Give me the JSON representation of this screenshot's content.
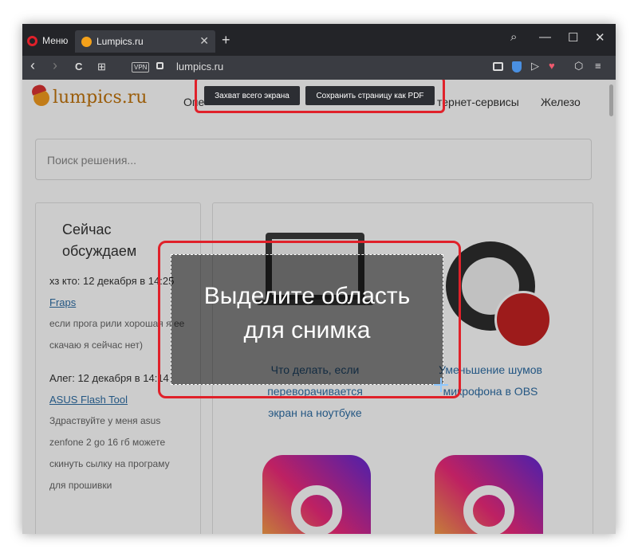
{
  "browser": {
    "menu_label": "Меню",
    "tab_title": "Lumpics.ru",
    "tab_close": "✕",
    "new_tab": "+",
    "address": "lumpics.ru",
    "vpn_badge": "VPN",
    "window_controls": {
      "search": "⌕",
      "minimize": "—",
      "maximize": "☐",
      "close": "✕"
    },
    "nav": {
      "back": "‹",
      "forward": "›",
      "reload": "C",
      "grid": "⊞"
    }
  },
  "snapshot_toolbar": {
    "full_screen_label": "Захват всего экрана",
    "save_pdf_label": "Сохранить страницу как PDF"
  },
  "selection": {
    "hint_line1": "Выделите область",
    "hint_line2": "для снимка"
  },
  "page": {
    "logo_text": "lumpics.ru",
    "nav_partial_left": "Опе",
    "nav_partial_internet": "тернет-сервисы",
    "nav_hardware": "Железо",
    "search_placeholder": "Поиск решения...",
    "discussions": {
      "title": "Сейчас обсуждаем",
      "entries": [
        {
          "meta": "хз кто: 12 декабря в 14:25",
          "link": "Fraps",
          "text": "если прога рили хорошая я ее скачаю я сейчас нет)"
        },
        {
          "meta": "Алег: 12 декабря в 14:14",
          "link": "ASUS Flash Tool",
          "text": "Здраствуйте у меня asus zenfone 2 go 16 гб можете скинуть сылку на програму для прошивки"
        }
      ]
    },
    "articles": [
      {
        "title": "Что делать, если переворачивается экран на ноутбуке"
      },
      {
        "title": "Уменьшение шумов микрофона в OBS"
      }
    ]
  },
  "colors": {
    "accent_red": "#e0212a",
    "link_blue": "#2e6da4",
    "logo_orange": "#c1730b"
  }
}
